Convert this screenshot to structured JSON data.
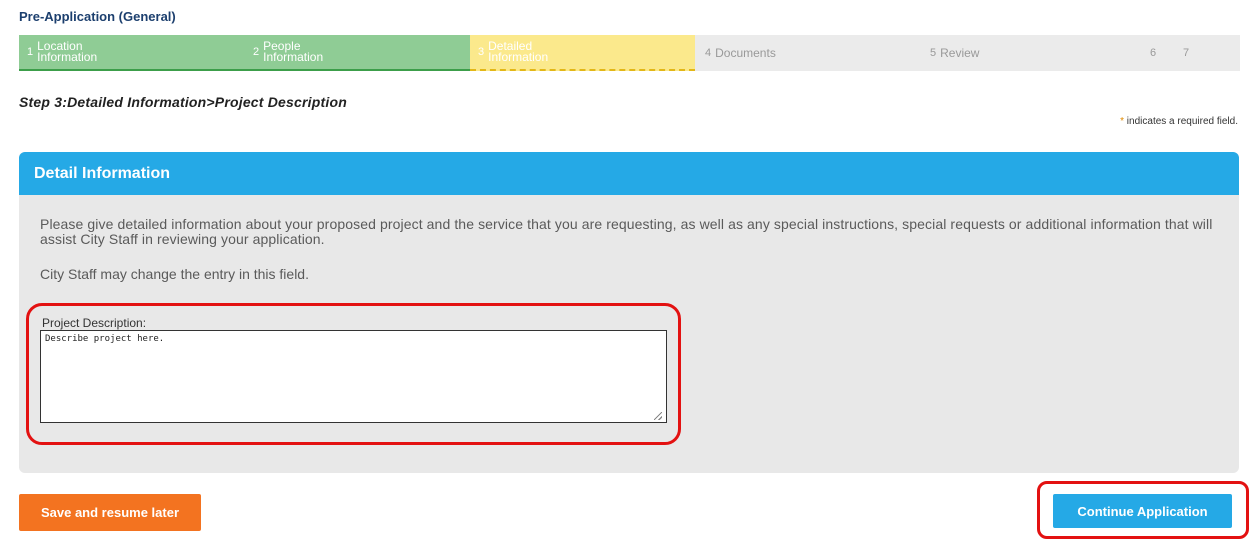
{
  "app_title": "Pre-Application (General)",
  "steps": [
    {
      "num": "1",
      "label": "Location Information",
      "state": "done"
    },
    {
      "num": "2",
      "label": "People Information",
      "state": "done"
    },
    {
      "num": "3",
      "label": "Detailed Information",
      "state": "current"
    },
    {
      "num": "4",
      "label": "Documents",
      "state": "todo"
    },
    {
      "num": "5",
      "label": "Review",
      "state": "todo"
    },
    {
      "num": "6",
      "label": "",
      "state": "todo"
    },
    {
      "num": "7",
      "label": "",
      "state": "todo"
    }
  ],
  "step_heading": "Step 3:Detailed Information>Project Description",
  "required_note": {
    "star": "*",
    "text": " indicates a required field."
  },
  "panel": {
    "title": "Detail Information",
    "info": "Please give detailed information about your proposed project and the service that you are requesting, as well as any special instructions, special requests or additional information that will assist City Staff in reviewing your application.",
    "staff_note": "City Staff may change the entry in this field."
  },
  "project_description": {
    "label": "Project Description:",
    "value": "Describe project here."
  },
  "buttons": {
    "save_label": "Save and resume later",
    "continue_label": "Continue Application"
  },
  "colors": {
    "accent": "#25a9e6",
    "save": "#f37320",
    "done_step": "#8fcc95",
    "current_step": "#fbe98c",
    "highlight": "#e31111"
  }
}
